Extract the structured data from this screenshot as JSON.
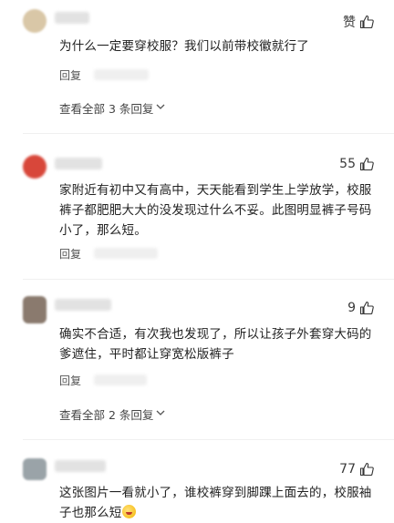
{
  "comments": [
    {
      "avatar_color": "#d9c7a7",
      "like_label": "赞",
      "text": "为什么一定要穿校服？我们以前带校徽就行了",
      "reply_label": "回复",
      "view_all": "查看全部 3 条回复"
    },
    {
      "avatar_color": "#d8473a",
      "like_count": "55",
      "text": "家附近有初中又有高中，天天能看到学生上学放学，校服裤子都肥肥大大的没发现过什么不妥。此图明显裤子号码小了，那么短。",
      "reply_label": "回复"
    },
    {
      "avatar_color": "#8a7a6e",
      "like_count": "9",
      "text": "确实不合适，有次我也发现了，所以让孩子外套穿大码的爹遮住，平时都让穿宽松版裤子",
      "reply_label": "回复",
      "view_all": "查看全部 2 条回复"
    },
    {
      "avatar_color": "#9aa3a8",
      "like_count": "77",
      "text": "这张图片一看就小了，谁校裤穿到脚踝上面去的，校服袖子也那么短"
    }
  ],
  "icons": {
    "thumb": "thumbs-up-icon",
    "chevron": "chevron-down-icon",
    "emoji": "grinning-face-emoji-icon"
  }
}
